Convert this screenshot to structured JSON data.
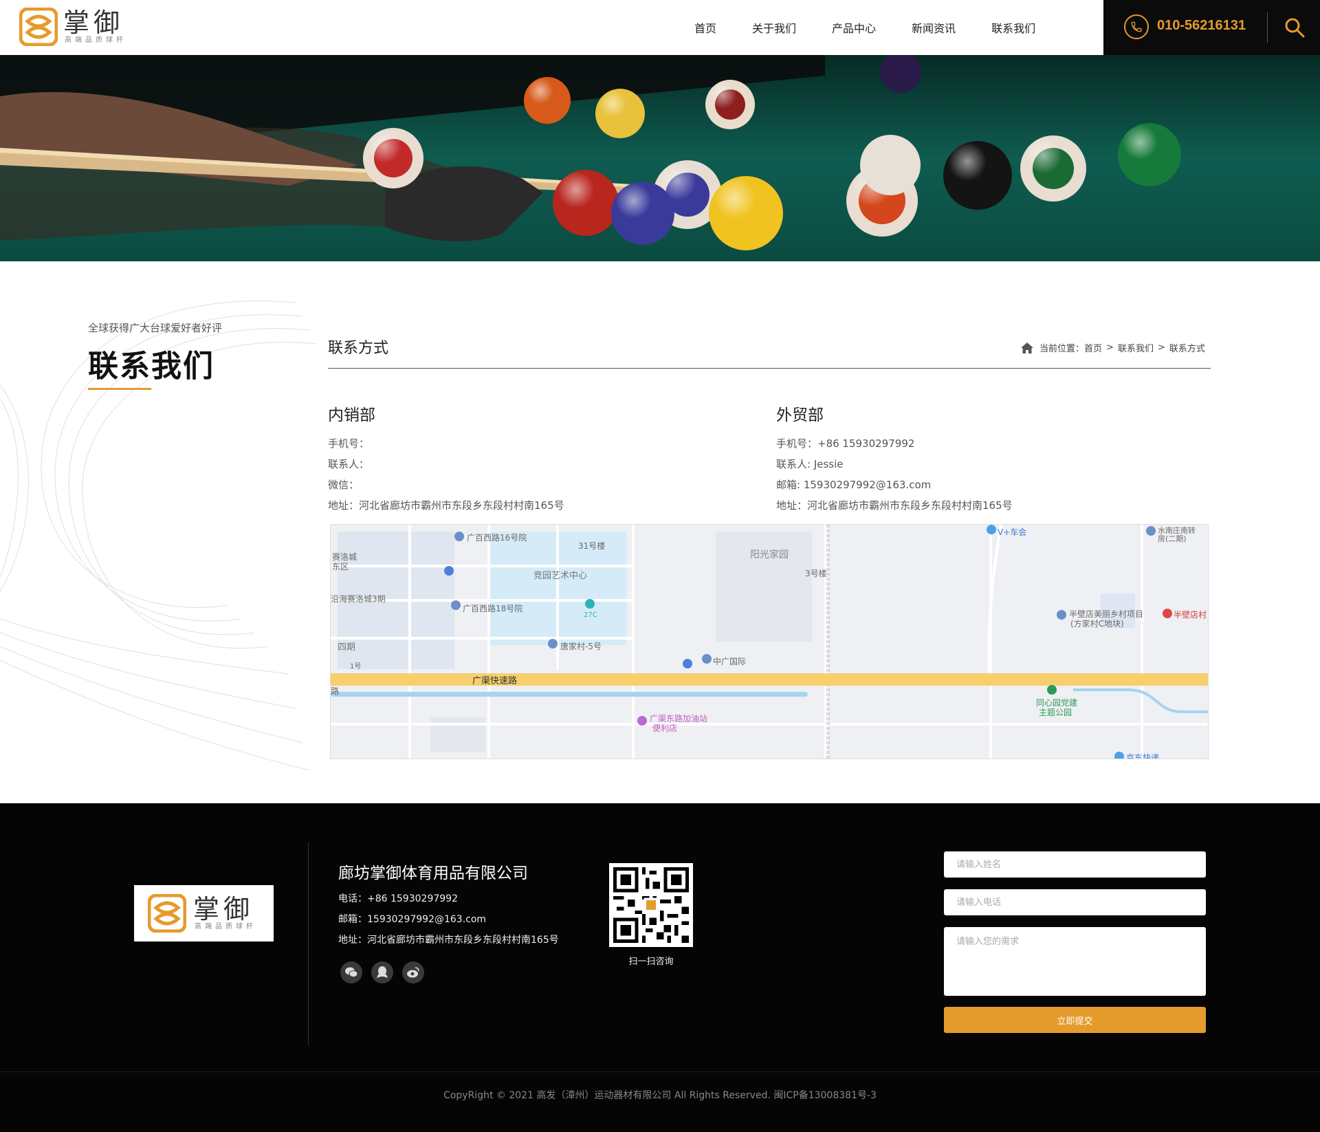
{
  "header": {
    "logo_text": "掌御",
    "logo_sub": "高端品质球杆",
    "nav": [
      "首页",
      "关于我们",
      "产品中心",
      "新闻资讯",
      "联系我们"
    ],
    "phone": "010-56216131"
  },
  "side": {
    "subtitle": "全球获得广大台球爱好者好评",
    "title": "联系我们"
  },
  "main": {
    "section_title": "联系方式",
    "breadcrumb": {
      "prefix": "当前位置：",
      "items": [
        "首页",
        "联系我们",
        "联系方式"
      ],
      "separator": ">"
    },
    "departments": [
      {
        "name": "内销部",
        "lines": [
          "手机号：",
          "联系人：",
          "微信：",
          "地址：河北省廊坊市霸州市东段乡东段村村南165号"
        ]
      },
      {
        "name": "外贸部",
        "lines": [
          "手机号：+86 15930297992",
          "联系人: Jessie",
          "邮箱: 15930297992@163.com",
          "地址：河北省廊坊市霸州市东段乡东段村村南165号"
        ]
      }
    ],
    "map_labels": {
      "l1": "广百西路16号院",
      "l2": "31号楼",
      "l3": "阳光家园",
      "l4": "竞园艺术中心",
      "l5": "3号楼",
      "l6": "沿海赛洛城3期",
      "l7": "广百西路18号院",
      "l8": "27C",
      "l9": "四期",
      "l10": "唐家村-5号",
      "l11": "中广国际",
      "l12": "1号",
      "l13": "广渠快速路",
      "l14": "广渠东路加油站",
      "l15": "便利店",
      "l16": "V+车会",
      "l17": "水南庄南转",
      "l18": "房(二期)",
      "l19": "半壁店美丽乡村项目",
      "l20": "(方家村C地块)",
      "l21": "半壁店村",
      "l22": "同心园党建",
      "l23": "主题公园",
      "l24": "京东快递",
      "l25": "赛洛城",
      "l26": "东区",
      "l27": "路"
    }
  },
  "footer": {
    "company": "廊坊掌御体育用品有限公司",
    "phone_line": "电话：+86 15930297992",
    "email_line": "邮箱：15930297992@163.com",
    "address_line": "地址：河北省廊坊市霸州市东段乡东段村村南165号",
    "qr_caption": "扫一扫咨询",
    "form": {
      "name_placeholder": "请输入姓名",
      "phone_placeholder": "请输入电话",
      "need_placeholder": "请输入您的需求",
      "submit": "立即提交"
    },
    "copyright": "CopyRight © 2021 高发（漳州）运动器材有限公司 All Rights Reserved.  闽ICP备13008381号-3"
  },
  "colors": {
    "accent": "#e59b2c",
    "footer_bg": "#050505",
    "header_right_bg": "#0b0b0b",
    "felt": "#0d4a40"
  }
}
